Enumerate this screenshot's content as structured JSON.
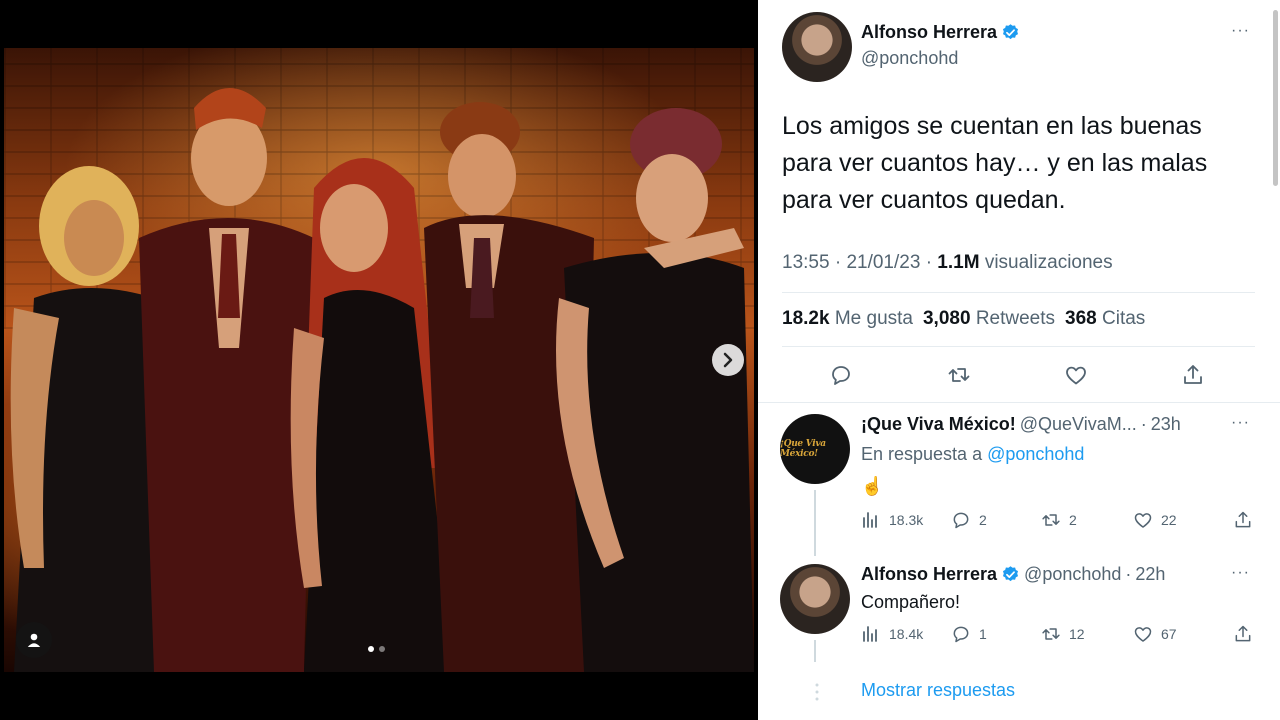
{
  "photo": {
    "carousel_total": 2,
    "carousel_active": 1,
    "icons": {
      "next": "chevron-right-icon",
      "tagged_user": "user-icon"
    }
  },
  "tweet": {
    "author": {
      "name": "Alfonso Herrera",
      "handle": "@ponchohd",
      "verified": true
    },
    "text": "Los amigos se cuentan en las buenas para ver cuantos hay… y en las malas para ver cuantos quedan.",
    "time": "13:55",
    "date": "21/01/23",
    "views_count": "1.1M",
    "views_label": "visualizaciones",
    "likes_count": "18.2k",
    "likes_label": "Me gusta",
    "retweets_count": "3,080",
    "retweets_label": "Retweets",
    "quotes_count": "368",
    "quotes_label": "Citas",
    "more": "···",
    "actions": [
      "reply-icon",
      "retweet-icon",
      "like-icon",
      "share-icon"
    ]
  },
  "replies": [
    {
      "name": "¡Que Viva México!",
      "handle": "@QueVivaM...",
      "time": "23h",
      "avatar_text": "¡Que Viva México!",
      "in_reply_prefix": "En respuesta a",
      "in_reply_handle": "@ponchohd",
      "body": "☝️",
      "views": "18.3k",
      "replies": "2",
      "retweets": "2",
      "likes": "22"
    },
    {
      "name": "Alfonso Herrera",
      "handle": "@ponchohd",
      "time": "22h",
      "body": "Compañero!",
      "views": "18.4k",
      "replies": "1",
      "retweets": "12",
      "likes": "67"
    }
  ],
  "separator": "·",
  "show_replies": "Mostrar respuestas",
  "colors": {
    "accent": "#1d9bf0",
    "secondary_text": "#536471",
    "divider": "#e6ecf0"
  }
}
